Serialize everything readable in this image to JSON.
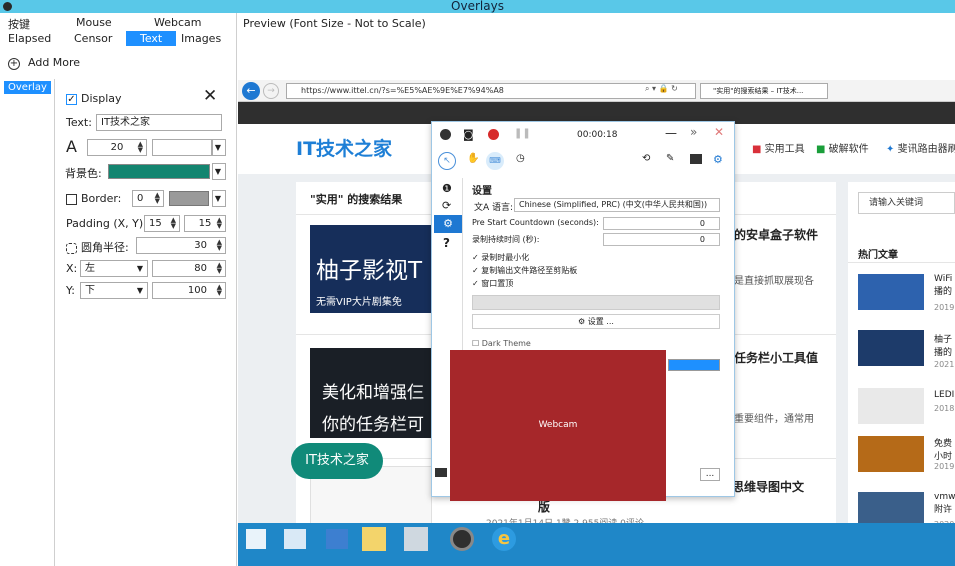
{
  "window": {
    "title": "Overlays"
  },
  "tabs": {
    "hotkeys": "按键",
    "mouse": "Mouse",
    "webcam": "Webcam",
    "elapsed": "Elapsed",
    "censor": "Censor",
    "text": "Text",
    "images": "Images"
  },
  "add_more": "Add More",
  "overlay_list": {
    "item": "Overlay"
  },
  "text_overlay": {
    "display_label": "Display",
    "close_icon": "close-icon",
    "text_label": "Text:",
    "text_value": "IT技术之家",
    "font_size": "20",
    "background_label": "背景色:",
    "background_color": "#138570",
    "border_label": "Border:",
    "border_value": "0",
    "padding_label": "Padding (X, Y):",
    "padding_x": "15",
    "padding_y": "15",
    "radius_label": "圆角半径:",
    "radius_value": "30",
    "x_label": "X:",
    "x_align": "左",
    "x_value": "80",
    "y_label": "Y:",
    "y_align": "下",
    "y_value": "100"
  },
  "preview": {
    "title": "Preview (Font Size - Not to Scale)",
    "url": "https://www.ittel.cn/?s=%E5%AE%9E%E7%94%A8",
    "tab_label": "\"实用\"的搜索结果 – IT技术...",
    "site_brand": "IT技术之家",
    "nav_items": [
      "实用工具",
      "破解软件",
      "斐讯路由器刷"
    ],
    "search_title": "\"实用\" 的搜索结果",
    "search_placeholder": "请输入关键词",
    "hot_title": "热门文章",
    "article1_banner": "柚子影视T",
    "article1_sub": "无需VIP大片剧集免",
    "article1_title": "的安卓盒子软件",
    "article1_desc": "是直接抓取展现各",
    "article2_banner": "美化和增强仨",
    "article2_sub": "你的任务栏可",
    "article2_title": "任务栏小工具值",
    "article2_desc": "重要组件，通常用",
    "article3_title": "）思维导图中文",
    "article3_title2": "版",
    "article3_meta": "2021年1月14日    1赞    2,955阅读    0评论",
    "side_items": [
      "WiFi 播的",
      "柚子 播的",
      "LEDI",
      "免费 小时",
      "vmwa 附许"
    ],
    "side_years": [
      "2019",
      "2021",
      "2018",
      "2019",
      "2020"
    ],
    "bubble_text": "IT技术之家",
    "webcam_label": "Webcam"
  },
  "recorder": {
    "timer": "00:00:18",
    "settings_title": "设置",
    "language_label": "语言:",
    "language_value": "Chinese (Simplified, PRC) (中文(中华人民共和国))",
    "countdown_label": "Pre Start Countdown (seconds):",
    "countdown_value": "0",
    "duration_label": "录制持续时间 (秒):",
    "duration_value": "0",
    "opt1": "录制时最小化",
    "opt2": "复制输出文件路径至剪贴板",
    "opt3": "窗口置顶",
    "settings_button": "设置 ...",
    "dark_theme": "Dark Theme",
    "ellipsis": "..."
  }
}
